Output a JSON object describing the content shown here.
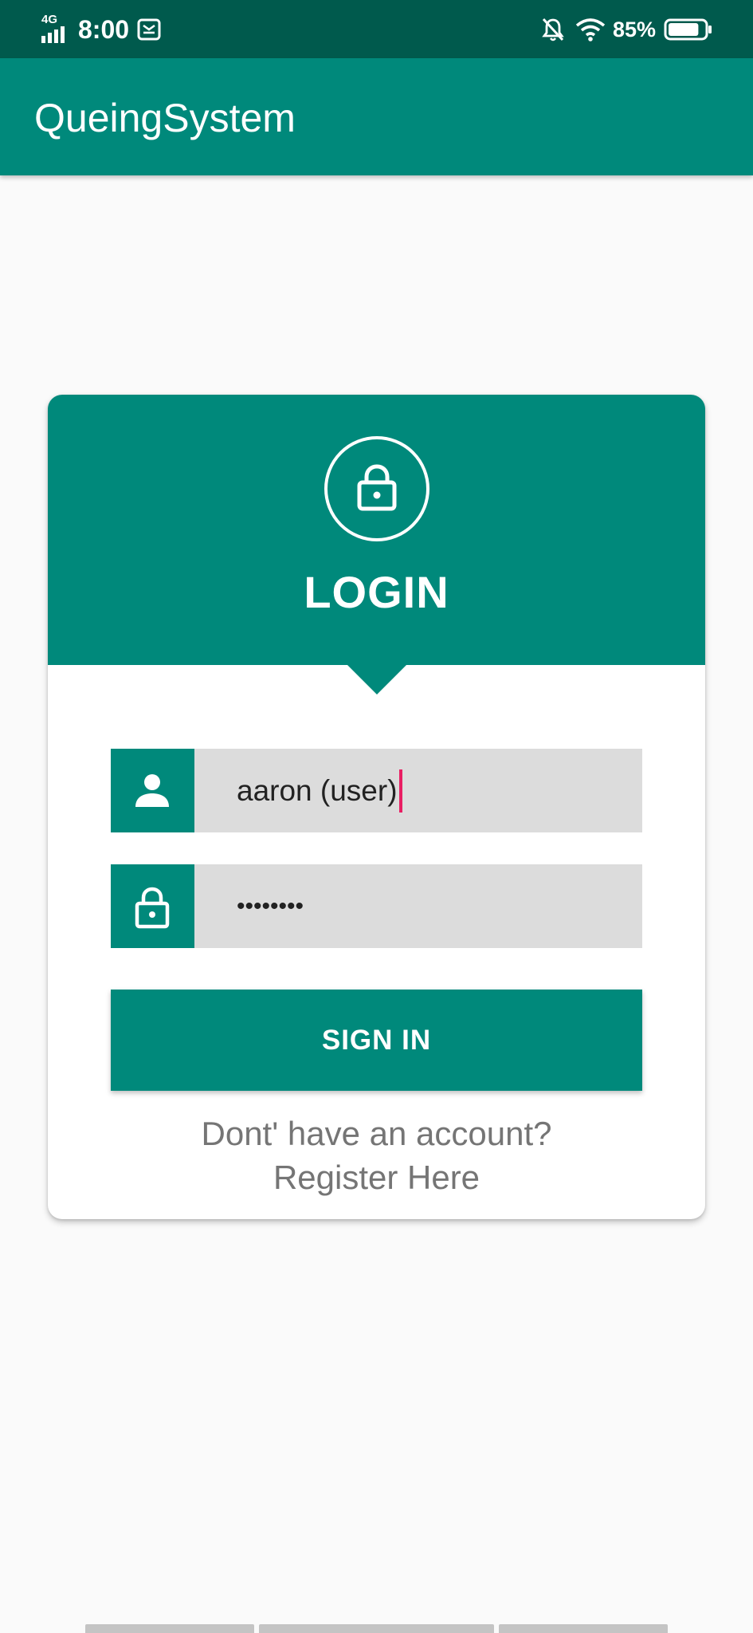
{
  "status_bar": {
    "network": "4G",
    "time": "8:00",
    "battery_percent": "85%",
    "battery_level": 0.85,
    "icons": [
      "signal-icon",
      "message-notification-icon",
      "mute-icon",
      "wifi-icon",
      "battery-icon"
    ]
  },
  "app_bar": {
    "title": "QueingSystem"
  },
  "login": {
    "header_icon": "lock-icon",
    "title": "LOGIN",
    "username": {
      "icon": "person-icon",
      "value": "aaron (user)"
    },
    "password": {
      "icon": "lock-icon",
      "value": "••••••••"
    },
    "sign_in_label": "SIGN IN",
    "register_line1": "Dont' have an account?",
    "register_line2": "Register Here"
  },
  "colors": {
    "primary": "#00897b",
    "primary_dark": "#005a4d",
    "accent": "#e91e63",
    "field_background": "#dcdcdc",
    "page_background": "#fafafa",
    "secondary_text": "#757575"
  }
}
